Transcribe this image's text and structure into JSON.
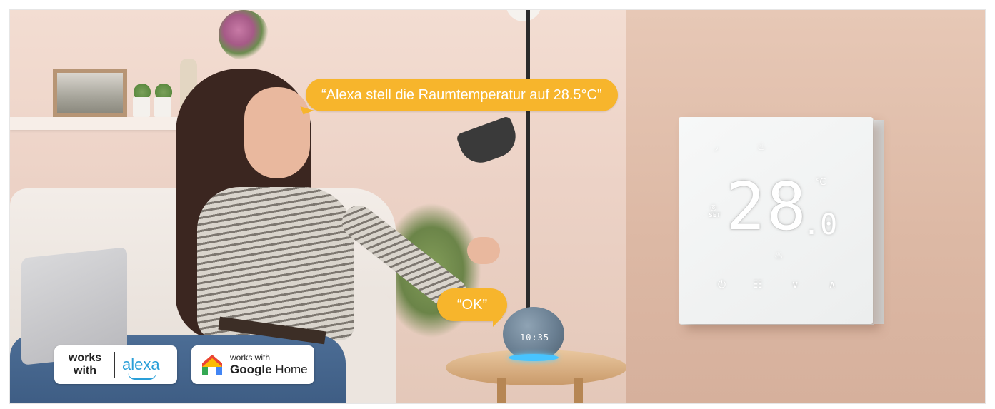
{
  "scene": {
    "speech_bubbles": {
      "command": "“Alexa stell die Raumtemperatur auf 28.5°C”",
      "reply": "“OK”"
    },
    "echo_clock": "10:35",
    "thermostat": {
      "reading_main": "28",
      "reading_decimal": ".0",
      "icons": [
        "wifi-icon",
        "flame-icon",
        "celsius-icon",
        "set-icon",
        "heating-icon",
        "power-icon",
        "mode-icon",
        "down-arrow-icon",
        "up-arrow-icon"
      ]
    }
  },
  "badges": {
    "alexa": {
      "works_line1": "works",
      "works_line2": "with",
      "brand": "alexa",
      "color": "#2a9fd8"
    },
    "google": {
      "works_with": "works with",
      "brand_bold": "Google",
      "brand_regular": " Home"
    }
  },
  "colors": {
    "bubble": "#f7b52c",
    "wall": "#ddb9a5",
    "thermostat": "#f2f3f3"
  }
}
